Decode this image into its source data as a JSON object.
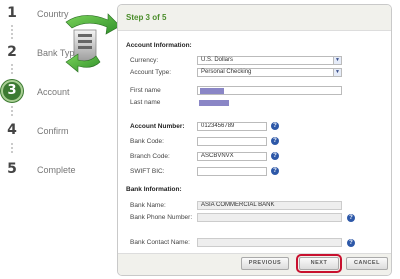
{
  "steps": [
    {
      "num": "1",
      "label": "Country"
    },
    {
      "num": "2",
      "label": "Bank Type"
    },
    {
      "num": "3",
      "label": "Account"
    },
    {
      "num": "4",
      "label": "Confirm"
    },
    {
      "num": "5",
      "label": "Complete"
    }
  ],
  "current_step": 3,
  "panel": {
    "title": "Step 3 of 5",
    "account_info": {
      "heading": "Account Information:",
      "currency_label": "Currency:",
      "currency_value": "U.S. Dollars",
      "account_type_label": "Account Type:",
      "account_type_value": "Personal Checking",
      "first_name_label": "First name",
      "last_name_label": "Last name",
      "account_number_label": "Account Number:",
      "account_number_value": "0123456789",
      "bank_code_label": "Bank Code:",
      "bank_code_value": "",
      "branch_code_label": "Branch Code:",
      "branch_code_value": "ASCBVNVX",
      "swift_label": "SWIFT BIC:",
      "swift_value": ""
    },
    "bank_info": {
      "heading": "Bank Information:",
      "bank_name_label": "Bank Name:",
      "bank_name_value": "ASIA COMMERCIAL BANK",
      "bank_phone_label": "Bank Phone Number:",
      "bank_phone_value": "",
      "bank_contact_label": "Bank Contact Name:",
      "bank_contact_value": ""
    },
    "help_glyph": "?",
    "dropdown_glyph": "▼"
  },
  "buttons": {
    "previous": "PREVIOUS",
    "next": "NEXT",
    "cancel": "CANCEL"
  },
  "colors": {
    "accent_green": "#4a8d2a",
    "current_step_fill": "#3c7a32",
    "help_blue": "#2d58a8",
    "next_highlight": "#c8102e",
    "redaction": "#8a86c6"
  },
  "icons": {
    "sync": "sync-arrows-icon"
  }
}
